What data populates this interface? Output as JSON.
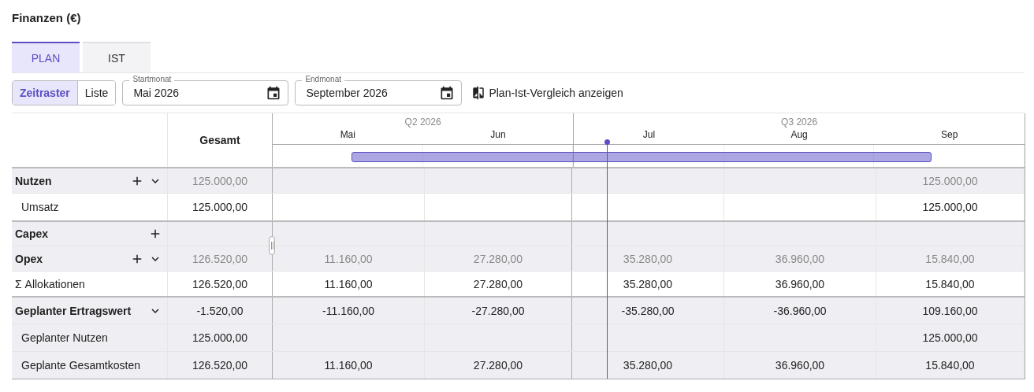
{
  "title": "Finanzen (€)",
  "tabs": [
    {
      "label": "PLAN",
      "selected": true
    },
    {
      "label": "IST",
      "selected": false
    }
  ],
  "view_toggle": [
    {
      "label": "Zeitraster",
      "selected": true
    },
    {
      "label": "Liste",
      "selected": false
    }
  ],
  "start_field": {
    "label": "Startmonat",
    "value": "Mai 2026"
  },
  "end_field": {
    "label": "Endmonat",
    "value": "September 2026"
  },
  "compare_button": {
    "label": "Plan-Ist-Vergleich anzeigen"
  },
  "table": {
    "total_header": "Gesamt",
    "quarters": [
      {
        "label": "Q2 2026",
        "months": [
          "Mai",
          "Jun"
        ]
      },
      {
        "label": "Q3 2026",
        "months": [
          "Jul",
          "Aug",
          "Sep"
        ]
      }
    ],
    "rows": [
      {
        "kind": "group",
        "label": "Nutzen",
        "add": true,
        "expanded": true,
        "muted": true,
        "shaded": true,
        "section_start": false,
        "values": {
          "total": "125.000,00",
          "month_5": "125.000,00"
        }
      },
      {
        "kind": "item",
        "label": "Umsatz",
        "muted": false,
        "shaded": false,
        "section_start": false,
        "values": {
          "total": "125.000,00",
          "month_5": "125.000,00"
        }
      },
      {
        "kind": "group",
        "label": "Capex",
        "add": true,
        "shaded": true,
        "section_start": true
      },
      {
        "kind": "group",
        "label": "Opex",
        "add": true,
        "expanded": true,
        "muted": true,
        "shaded": true,
        "section_start": false,
        "values": {
          "total": "126.520,00",
          "month_1": "11.160,00",
          "month_2": "27.280,00",
          "month_3": "35.280,00",
          "month_4": "36.960,00",
          "month_5": "15.840,00"
        }
      },
      {
        "kind": "sum",
        "label": "Σ Allokationen",
        "muted": false,
        "shaded": false,
        "section_start": false,
        "values": {
          "total": "126.520,00",
          "month_1": "11.160,00",
          "month_2": "27.280,00",
          "month_3": "35.280,00",
          "month_4": "36.960,00",
          "month_5": "15.840,00"
        }
      },
      {
        "kind": "group",
        "label": "Geplanter Ertragswert",
        "add": false,
        "expanded": true,
        "muted": false,
        "shaded": true,
        "section_start": true,
        "values": {
          "total": "-1.520,00",
          "month_1": "-11.160,00",
          "month_2": "-27.280,00",
          "month_3": "-35.280,00",
          "month_4": "-36.960,00",
          "month_5": "109.160,00"
        }
      },
      {
        "kind": "item",
        "label": "Geplanter Nutzen",
        "muted": false,
        "shaded": true,
        "section_start": false,
        "values": {
          "total": "125.000,00",
          "month_5": "125.000,00"
        }
      },
      {
        "kind": "item",
        "label": "Geplante Gesamtkosten",
        "muted": false,
        "shaded": true,
        "section_start": false,
        "values": {
          "total": "126.520,00",
          "month_1": "11.160,00",
          "month_2": "27.280,00",
          "month_3": "35.280,00",
          "month_4": "36.960,00",
          "month_5": "15.840,00"
        }
      }
    ]
  }
}
